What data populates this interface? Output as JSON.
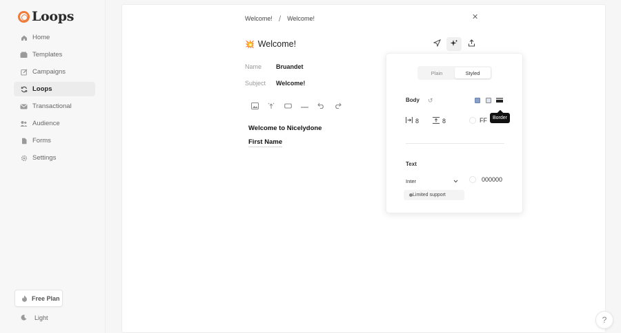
{
  "brand": {
    "name": "Loops",
    "accent": "#f07c3c"
  },
  "sidebar": {
    "items": [
      {
        "label": "Home",
        "icon": "home-icon"
      },
      {
        "label": "Templates",
        "icon": "templates-icon"
      },
      {
        "label": "Campaigns",
        "icon": "campaigns-icon"
      },
      {
        "label": "Loops",
        "icon": "loops-icon",
        "active": true
      },
      {
        "label": "Transactional",
        "icon": "transactional-icon"
      },
      {
        "label": "Audience",
        "icon": "audience-icon"
      },
      {
        "label": "Forms",
        "icon": "forms-icon"
      },
      {
        "label": "Settings",
        "icon": "settings-icon"
      }
    ],
    "plan_label": "Free Plan",
    "theme_label": "Light"
  },
  "breadcrumb": {
    "first": "Welcome!",
    "separator": "/",
    "second": "Welcome!"
  },
  "email": {
    "title": "Welcome!",
    "name_label": "Name",
    "name_value": "Bruandet",
    "subject_label": "Subject",
    "subject_value": "Welcome!"
  },
  "content": {
    "line1": "Welcome to Nicelydone",
    "line2": "First Name"
  },
  "styles_panel": {
    "tabs": [
      "Plain",
      "Styled"
    ],
    "active_tab": "Styled",
    "body_label": "Body",
    "tooltip": "Border",
    "padding_x": "8",
    "padding_y": "8",
    "background_value": "FF",
    "text_label": "Text",
    "font_value": "Inter",
    "text_color_value": "000000",
    "limited_support": "Limited support"
  },
  "help_label": "?"
}
